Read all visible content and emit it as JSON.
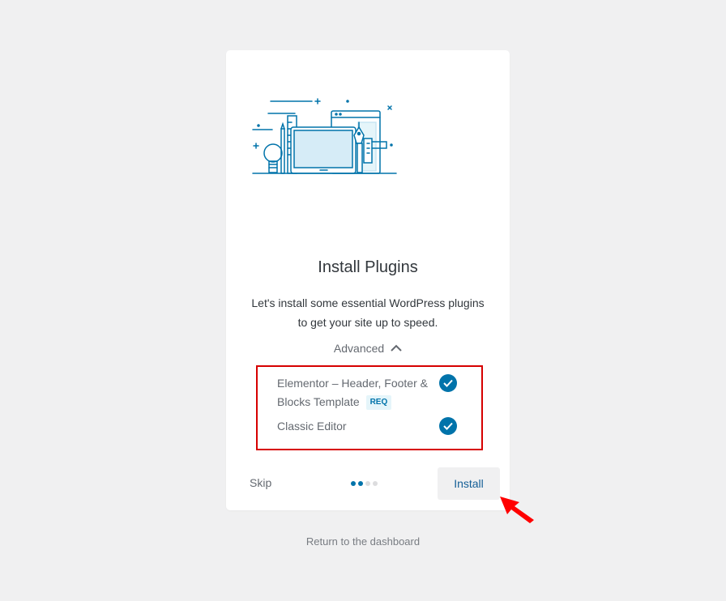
{
  "card": {
    "title": "Install Plugins",
    "description_line1": "Let's install some essential WordPress plugins",
    "description_line2": "to get your site up to speed.",
    "advanced_label": "Advanced",
    "plugins": [
      {
        "name_line1": "Elementor – Header, Footer &",
        "name_line2": "Blocks Template",
        "badge": "REQ",
        "checked": true
      },
      {
        "name_line1": "Classic Editor",
        "checked": true
      }
    ],
    "skip_label": "Skip",
    "install_label": "Install",
    "pagination": {
      "total": 4,
      "active": [
        1,
        2
      ]
    }
  },
  "footer": {
    "return_link": "Return to the dashboard"
  },
  "colors": {
    "accent": "#0073aa",
    "highlight_border": "#d60000",
    "annotation_arrow": "#ff0000",
    "background": "#f0f0f1"
  },
  "icons": [
    "illustration-graphic",
    "chevron-up-icon",
    "check-icon",
    "annotation-arrow-icon"
  ]
}
